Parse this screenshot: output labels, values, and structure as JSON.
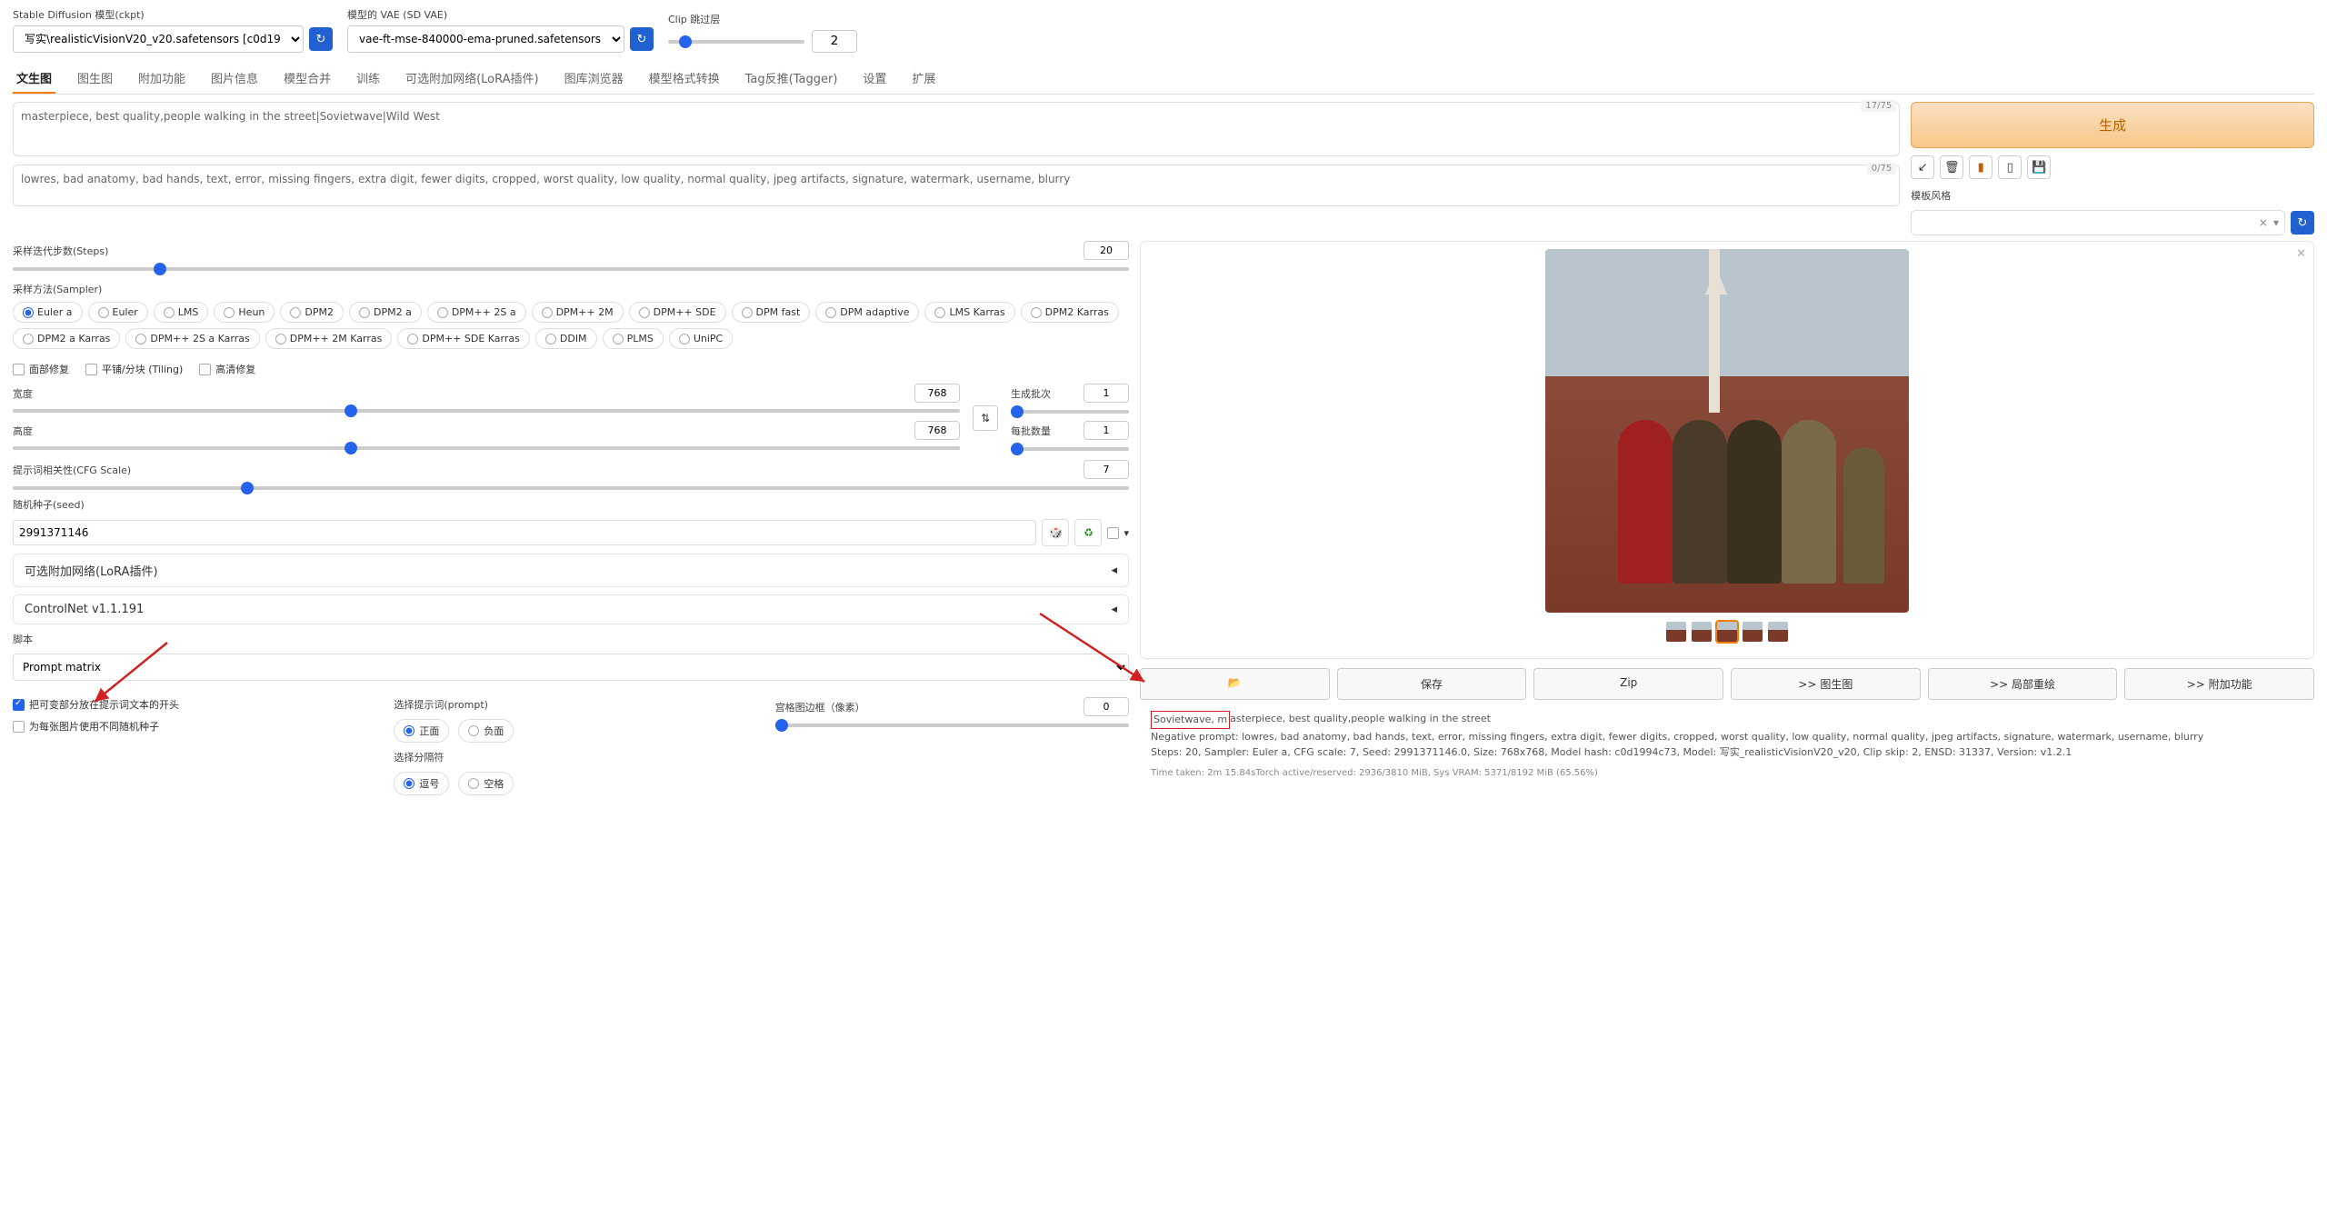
{
  "header": {
    "model_label": "Stable Diffusion 模型(ckpt)",
    "model_value": "写实\\realisticVisionV20_v20.safetensors [c0d19",
    "vae_label": "模型的 VAE (SD VAE)",
    "vae_value": "vae-ft-mse-840000-ema-pruned.safetensors",
    "clip_label": "Clip 跳过层",
    "clip_value": "2"
  },
  "tabs": [
    "文生图",
    "图生图",
    "附加功能",
    "图片信息",
    "模型合并",
    "训练",
    "可选附加网络(LoRA插件)",
    "图库浏览器",
    "模型格式转换",
    "Tag反推(Tagger)",
    "设置",
    "扩展"
  ],
  "active_tab": 0,
  "prompt": {
    "positive": "masterpiece, best quality,people walking in the street|Sovietwave|Wild West",
    "positive_tokens": "17/75",
    "negative": "lowres, bad anatomy, bad hands, text, error, missing fingers, extra digit, fewer digits, cropped, worst quality, low quality, normal quality, jpeg artifacts, signature, watermark, username, blurry",
    "negative_tokens": "0/75"
  },
  "right": {
    "generate": "生成",
    "style_label": "模板风格"
  },
  "params": {
    "steps_label": "采样迭代步数(Steps)",
    "steps": "20",
    "sampler_label": "采样方法(Sampler)",
    "samplers": [
      "Euler a",
      "Euler",
      "LMS",
      "Heun",
      "DPM2",
      "DPM2 a",
      "DPM++ 2S a",
      "DPM++ 2M",
      "DPM++ SDE",
      "DPM fast",
      "DPM adaptive",
      "LMS Karras",
      "DPM2 Karras",
      "DPM2 a Karras",
      "DPM++ 2S a Karras",
      "DPM++ 2M Karras",
      "DPM++ SDE Karras",
      "DDIM",
      "PLMS",
      "UniPC"
    ],
    "sampler_selected": 0,
    "face_restore": "面部修复",
    "tiling": "平铺/分块 (Tiling)",
    "hires": "高清修复",
    "width_label": "宽度",
    "width": "768",
    "height_label": "高度",
    "height": "768",
    "batch_count_label": "生成批次",
    "batch_count": "1",
    "batch_size_label": "每批数量",
    "batch_size": "1",
    "cfg_label": "提示词相关性(CFG Scale)",
    "cfg": "7",
    "seed_label": "随机种子(seed)",
    "seed": "2991371146",
    "lora_accordion": "可选附加网络(LoRA插件)",
    "controlnet_accordion": "ControlNet v1.1.191",
    "script_label": "脚本",
    "script": "Prompt matrix",
    "pm_var_start": "把可变部分放在提示词文本的开头",
    "pm_diff_seed": "为每张图片使用不同随机种子",
    "pm_select_prompt": "选择提示词(prompt)",
    "pm_positive": "正面",
    "pm_negative": "负面",
    "pm_select_delim": "选择分隔符",
    "pm_comma": "逗号",
    "pm_space": "空格",
    "pm_margin_label": "宫格图边框（像素）",
    "pm_margin": "0"
  },
  "output": {
    "thumbs": 5,
    "thumb_selected": 2,
    "folder_icon": "📂",
    "save": "保存",
    "zip": "Zip",
    "to_img2img": ">> 图生图",
    "to_inpaint": ">> 局部重绘",
    "to_extras": ">> 附加功能",
    "info_line1_highlight": "Sovietwave, m",
    "info_line1_rest": "asterpiece, best quality,people walking in the street",
    "info_neg": "Negative prompt: lowres, bad anatomy, bad hands, text, error, missing fingers, extra digit, fewer digits, cropped, worst quality, low quality, normal quality, jpeg artifacts, signature, watermark, username, blurry",
    "info_steps": "Steps: 20, Sampler: Euler a, CFG scale: 7, Seed: 2991371146.0, Size: 768x768, Model hash: c0d1994c73, Model: 写实_realisticVisionV20_v20, Clip skip: 2, ENSD: 31337, Version: v1.2.1",
    "timing": "Time taken: 2m 15.84sTorch active/reserved: 2936/3810 MiB, Sys VRAM: 5371/8192 MiB (65.56%)"
  }
}
